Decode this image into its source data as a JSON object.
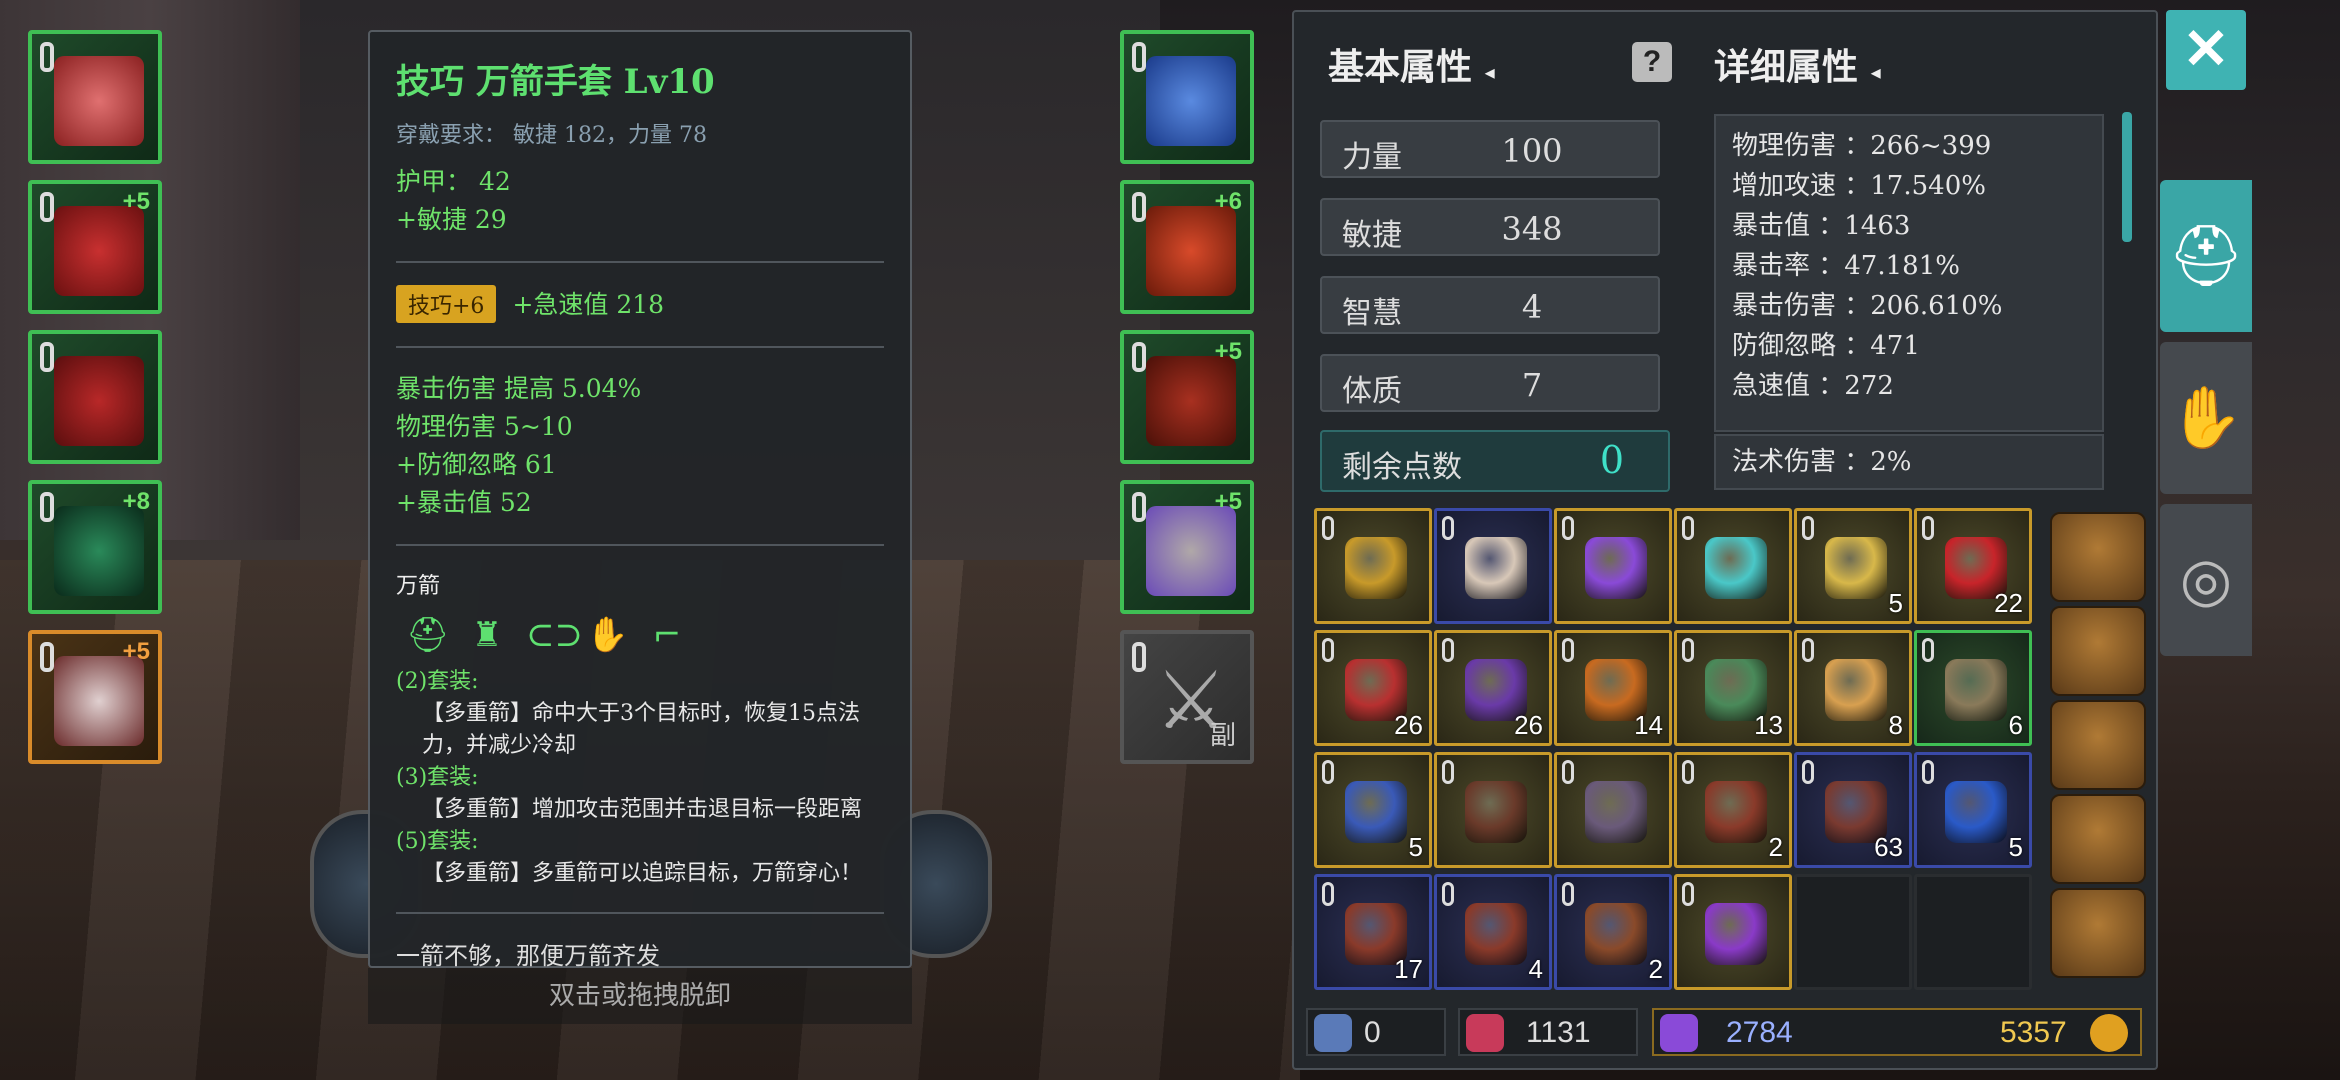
{
  "tooltip": {
    "title": "技巧 万箭手套 Lv10",
    "requirement": "穿戴要求：  敏捷 182，力量 78",
    "base_stats": [
      "护甲：  42",
      "+敏捷 29"
    ],
    "enhance_tag": "技巧+6",
    "enhance_stat": "+急速值 218",
    "affixes": [
      "暴击伤害 提高 5.04%",
      "物理伤害 5~10",
      "+防御忽略 61",
      "+暴击值 52"
    ],
    "set_name": "万箭",
    "set_bonuses": [
      {
        "tier": "(2)套装:",
        "desc": "【多重箭】命中大于3个目标时，恢复15点法力，并减少冷却"
      },
      {
        "tier": "(3)套装:",
        "desc": "【多重箭】增加攻击范围并击退目标一段距离"
      },
      {
        "tier": "(5)套装:",
        "desc": "【多重箭】多重箭可以追踪目标，万箭穿心！"
      }
    ],
    "flavor": "一箭不够，那便万箭齐发"
  },
  "unequip_hint": "双击或拖拽脱卸",
  "left_slots": [
    {
      "name": "helmet",
      "plus": ""
    },
    {
      "name": "chest",
      "plus": "+5"
    },
    {
      "name": "legs",
      "plus": ""
    },
    {
      "name": "ring",
      "plus": "+8"
    },
    {
      "name": "bow",
      "plus": "+5"
    }
  ],
  "right_slots": [
    {
      "name": "amulet",
      "plus": ""
    },
    {
      "name": "gloves",
      "plus": "+6"
    },
    {
      "name": "boots",
      "plus": "+5"
    },
    {
      "name": "ring2",
      "plus": "+5"
    },
    {
      "name": "offhand",
      "plus": "",
      "sub_label": "副"
    }
  ],
  "panel": {
    "basic_title": "基本属性",
    "detail_title": "详细属性",
    "basic_stats": [
      {
        "label": "力量",
        "value": "100"
      },
      {
        "label": "敏捷",
        "value": "348"
      },
      {
        "label": "智慧",
        "value": "4"
      },
      {
        "label": "体质",
        "value": "7"
      }
    ],
    "remaining": {
      "label": "剩余点数",
      "value": "0"
    },
    "details": [
      "物理伤害 ：266~399",
      "增加攻速 ：17.540%",
      "暴击值 ：1463",
      "暴击率 ：47.181%",
      "暴击伤害 ：206.610%",
      "防御忽略 ：471",
      "急速值 ：272"
    ],
    "magic_detail": "法术伤害 ：2%"
  },
  "inventory": [
    {
      "c": "#c89a2a",
      "n": "",
      "k": "gold"
    },
    {
      "c": "#d8c8b8",
      "n": "",
      "k": "blue"
    },
    {
      "c": "#8a4ad8",
      "n": "",
      "k": "gold"
    },
    {
      "c": "#4ac8c8",
      "n": "",
      "k": "gold"
    },
    {
      "c": "#d8b84a",
      "n": "5",
      "k": "gold"
    },
    {
      "c": "#c8242a",
      "n": "22",
      "k": "gold"
    },
    {
      "c": "#b83030",
      "n": "26",
      "k": "gold"
    },
    {
      "c": "#6a3aa8",
      "n": "26",
      "k": "gold"
    },
    {
      "c": "#c86a20",
      "n": "14",
      "k": "gold"
    },
    {
      "c": "#4a8a5a",
      "n": "13",
      "k": "gold"
    },
    {
      "c": "#d8a050",
      "n": "8",
      "k": "gold"
    },
    {
      "c": "#8a7a5a",
      "n": "6",
      "k": "green"
    },
    {
      "c": "#3a5ab8",
      "n": "5",
      "k": "gold"
    },
    {
      "c": "#6a3a2a",
      "n": "",
      "k": "gold"
    },
    {
      "c": "#6a5a7a",
      "n": "",
      "k": "gold"
    },
    {
      "c": "#8a3a2a",
      "n": "2",
      "k": "gold"
    },
    {
      "c": "#7a3a30",
      "n": "63",
      "k": "blue"
    },
    {
      "c": "#2a5ac8",
      "n": "5",
      "k": "blue"
    },
    {
      "c": "#8a3a2a",
      "n": "17",
      "k": "blue"
    },
    {
      "c": "#8a3a2a",
      "n": "4",
      "k": "blue"
    },
    {
      "c": "#8a4a2a",
      "n": "2",
      "k": "blue"
    },
    {
      "c": "#8a3ac8",
      "n": "",
      "k": "gold"
    },
    {
      "c": "",
      "n": "",
      "k": "empty"
    },
    {
      "c": "",
      "n": "",
      "k": "empty"
    }
  ],
  "currency": {
    "keys": "0",
    "gems": "1131",
    "crystals": "2784",
    "gold": "5357"
  },
  "colors": {
    "accent": "#3fb3b3",
    "green_text": "#6fe36a",
    "gold_border": "#c89a2a"
  }
}
